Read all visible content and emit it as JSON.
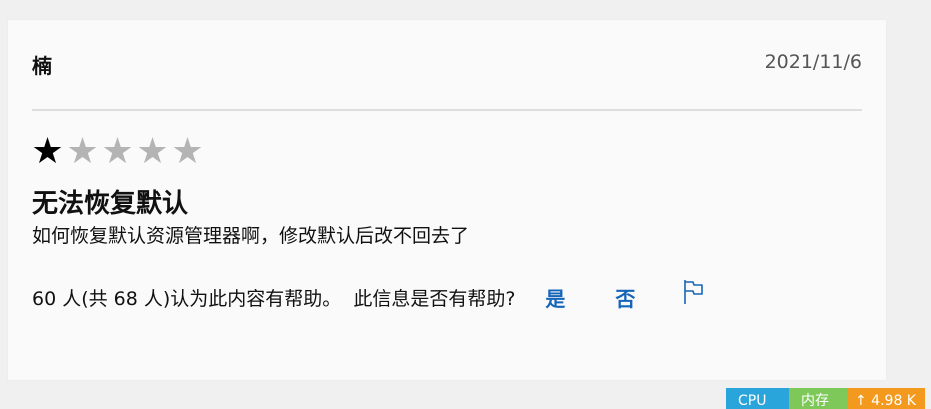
{
  "review": {
    "reviewer": "楠",
    "date": "2021/11/6",
    "rating": 1,
    "rating_max": 5,
    "star_filled_icon": "star-filled-icon",
    "star_empty_icon": "star-empty-icon",
    "title": "无法恢复默认",
    "body": "如何恢复默认资源管理器啊，修改默认后改不回去了",
    "helpful_count_text": "60 人(共 68 人)认为此内容有帮助。",
    "helpful_question": "此信息是否有帮助?",
    "vote_yes": "是",
    "vote_no": "否",
    "report_icon": "flag-icon"
  },
  "statusbar": {
    "cpu_label": "CPU",
    "mem_label": "内存",
    "net_label": "↑ 4.98 K",
    "colors": {
      "cpu": "#2aa5dc",
      "mem": "#7ec85a",
      "net": "#f39a1e"
    }
  },
  "colors": {
    "link": "#1565b8",
    "star_filled": "#000000",
    "star_empty": "#b4b4b4"
  }
}
